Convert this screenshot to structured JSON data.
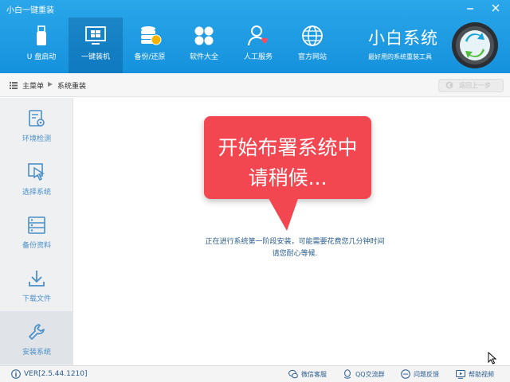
{
  "window": {
    "title": "小白一键重装",
    "minimize_icon": "minimize-icon",
    "close_icon": "close-icon"
  },
  "nav": {
    "items": [
      {
        "label": "U 盘启动",
        "icon": "usb-drive-icon",
        "active": false
      },
      {
        "label": "一键装机",
        "icon": "windows-monitor-icon",
        "active": true
      },
      {
        "label": "备份/还原",
        "icon": "database-icon",
        "active": false
      },
      {
        "label": "软件大全",
        "icon": "apps-grid-icon",
        "active": false
      },
      {
        "label": "人工服务",
        "icon": "user-heart-icon",
        "active": false
      },
      {
        "label": "官方网站",
        "icon": "globe-icon",
        "active": false
      }
    ]
  },
  "brand": {
    "name": "小白系统",
    "tagline": "最好用的系统重装工具"
  },
  "breadcrumb": {
    "home": "主菜单",
    "separator": "▶",
    "current": "系统重装",
    "back_button": "返回上一步"
  },
  "sidebar": {
    "items": [
      {
        "label": "环境检测",
        "icon": "environment-check-icon",
        "active": false
      },
      {
        "label": "选择系统",
        "icon": "select-cursor-icon",
        "active": false
      },
      {
        "label": "备份资料",
        "icon": "backup-list-icon",
        "active": false
      },
      {
        "label": "下载文件",
        "icon": "download-icon",
        "active": false
      },
      {
        "label": "安装系统",
        "icon": "wrench-icon",
        "active": true
      }
    ]
  },
  "main": {
    "bubble_line1": "开始布署系统中",
    "bubble_line2": "请稍候...",
    "status_line1": "正在进行系统第一阶段安装，可能需要花费您几分钟时间",
    "status_line2": "请您耐心等候."
  },
  "footer": {
    "version": "VER[2.5.44.1210]",
    "links": [
      {
        "label": "微信客服",
        "icon": "wechat-icon"
      },
      {
        "label": "QQ交流群",
        "icon": "qq-icon"
      },
      {
        "label": "问题反馈",
        "icon": "feedback-icon"
      },
      {
        "label": "帮助视频",
        "icon": "help-video-icon"
      }
    ]
  },
  "colors": {
    "header": "#1d9be4",
    "bubble": "#f24750",
    "link_text": "#2b5d8f",
    "sidebar_bg": "#eff0f2"
  }
}
